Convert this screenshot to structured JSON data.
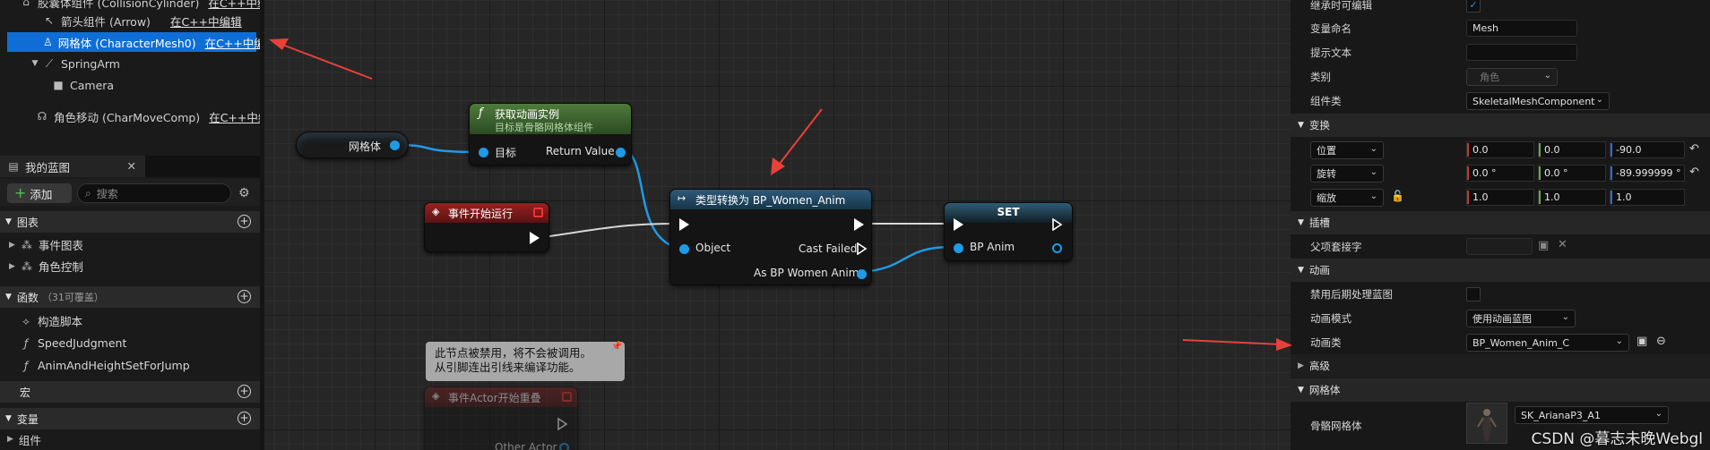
{
  "components": {
    "items": [
      {
        "label": "胶囊体组件 (CollisionCylinder)",
        "note": "在C++中编"
      },
      {
        "label": "箭头组件 (Arrow)",
        "note": "在C++中编辑"
      },
      {
        "label": "网格体 (CharacterMesh0)",
        "note": "在C++中编"
      },
      {
        "label": "SpringArm",
        "note": ""
      },
      {
        "label": "Camera",
        "note": ""
      },
      {
        "label": "角色移动 (CharMoveComp)",
        "note": "在C++中编"
      }
    ]
  },
  "my_blueprint": {
    "tab_label": "我的蓝图",
    "add_label": "添加",
    "search_placeholder": "搜索",
    "sections": {
      "graphs": "图表",
      "functions": "函数",
      "functions_sub": "（31可覆盖）",
      "macros": "宏",
      "variables": "变量"
    },
    "graph_items": [
      "事件图表",
      "角色控制"
    ],
    "function_items": [
      "构造脚本",
      "SpeedJudgment",
      "AnimAndHeightSetForJump"
    ],
    "variable_items": [
      "组件"
    ]
  },
  "graph": {
    "mesh_var": "网格体",
    "get_anim_title": "获取动画实例",
    "get_anim_subtitle": "目标是骨骼网格体组件",
    "target_label": "目标",
    "return_label": "Return Value",
    "event_begin_play": "事件开始运行",
    "cast_title": "类型转换为 BP_Women_Anim",
    "object_label": "Object",
    "cast_failed_label": "Cast Failed",
    "as_label": "As BP Women Anim",
    "set_title": "SET",
    "bp_anim_label": "BP Anim",
    "comment_text": "此节点被禁用，将不会被调用。\n从引脚连出引线来编译功能。",
    "disabled_event": "事件Actor开始重叠",
    "other_actor": "Other Actor"
  },
  "details": {
    "rows": {
      "inherit_editable": "继承时可编辑",
      "var_name": "变量命名",
      "var_name_value": "Mesh",
      "tooltip": "提示文本",
      "category": "类别",
      "category_value": "角色",
      "component_class": "组件类",
      "component_class_value": "SkeletalMeshComponent"
    },
    "transform": {
      "title": "变换",
      "location": "位置",
      "location_values": [
        "0.0",
        "0.0",
        "-90.0"
      ],
      "rotation": "旋转",
      "rotation_values": [
        "0.0 °",
        "0.0 °",
        "-89.999999 °"
      ],
      "scale": "缩放",
      "scale_values": [
        "1.0",
        "1.0",
        "1.0"
      ]
    },
    "sockets": {
      "title": "插槽",
      "parent_socket": "父项套接字"
    },
    "animation": {
      "title": "动画",
      "disable_post_process": "禁用后期处理蓝图",
      "anim_mode": "动画模式",
      "anim_mode_value": "使用动画蓝图",
      "anim_class": "动画类",
      "anim_class_value": "BP_Women_Anim_C"
    },
    "advanced": "高级",
    "mesh": {
      "title": "网格体",
      "skeletal_mesh": "骨骼网格体",
      "skeletal_mesh_value": "SK_ArianaP3_A1"
    }
  },
  "watermark": "CSDN @暮志未晚Webgl",
  "colors": {
    "selection": "#0e6ed6",
    "object_pin": "#1d9be6",
    "function_header": "#4f7a3c",
    "event_header": "#8b1e1e",
    "cast_header": "#2d5a7a",
    "annotation_arrow": "#e8413a"
  }
}
